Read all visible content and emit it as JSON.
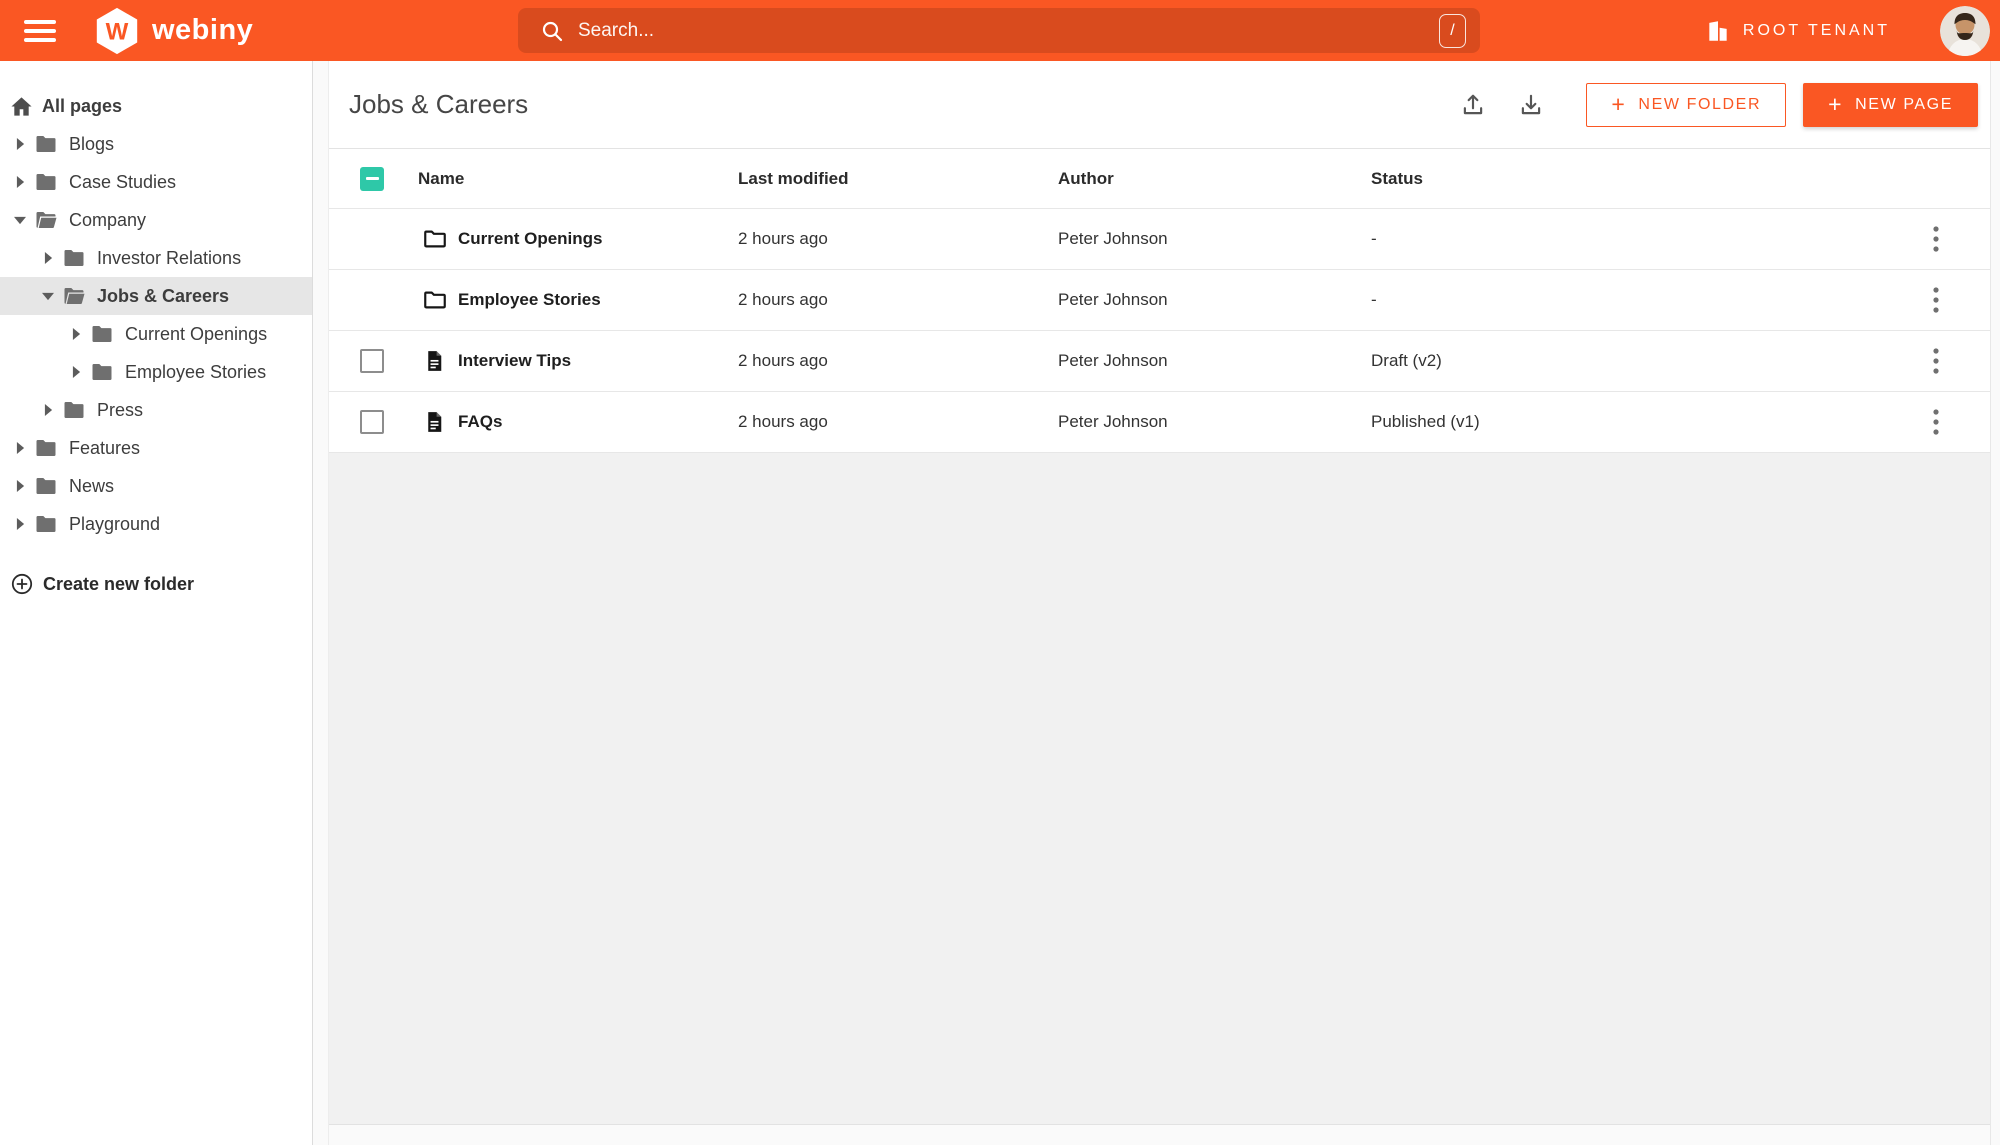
{
  "topbar": {
    "brand": "webiny",
    "search": {
      "placeholder": "Search...",
      "shortcut_key": "/"
    },
    "tenant_label": "ROOT TENANT"
  },
  "sidebar": {
    "items": [
      {
        "label": "All pages",
        "type": "home",
        "level": 0,
        "selected": false
      },
      {
        "label": "Blogs",
        "type": "folder",
        "level": 0,
        "expanded": false,
        "selected": false
      },
      {
        "label": "Case Studies",
        "type": "folder",
        "level": 0,
        "expanded": false,
        "selected": false
      },
      {
        "label": "Company",
        "type": "folder",
        "level": 0,
        "expanded": true,
        "selected": false
      },
      {
        "label": "Investor Relations",
        "type": "folder",
        "level": 1,
        "expanded": false,
        "selected": false
      },
      {
        "label": "Jobs & Careers",
        "type": "folder",
        "level": 1,
        "expanded": true,
        "selected": true
      },
      {
        "label": "Current Openings",
        "type": "folder",
        "level": 2,
        "expanded": false,
        "selected": false
      },
      {
        "label": "Employee Stories",
        "type": "folder",
        "level": 2,
        "expanded": false,
        "selected": false
      },
      {
        "label": "Press",
        "type": "folder",
        "level": 1,
        "expanded": false,
        "selected": false
      },
      {
        "label": "Features",
        "type": "folder",
        "level": 0,
        "expanded": false,
        "selected": false
      },
      {
        "label": "News",
        "type": "folder",
        "level": 0,
        "expanded": false,
        "selected": false
      },
      {
        "label": "Playground",
        "type": "folder",
        "level": 0,
        "expanded": false,
        "selected": false
      }
    ],
    "create_folder_label": "Create new folder"
  },
  "main": {
    "title": "Jobs & Careers",
    "toolbar": {
      "new_folder_label": "NEW FOLDER",
      "new_page_label": "NEW PAGE",
      "plus": "+"
    },
    "table": {
      "select_all_state": "indeterminate",
      "columns": {
        "name": "Name",
        "modified": "Last modified",
        "author": "Author",
        "status": "Status"
      },
      "rows": [
        {
          "name": "Current Openings",
          "type": "folder",
          "modified": "2 hours ago",
          "author": "Peter Johnson",
          "status": "-"
        },
        {
          "name": "Employee Stories",
          "type": "folder",
          "modified": "2 hours ago",
          "author": "Peter Johnson",
          "status": "-"
        },
        {
          "name": "Interview Tips",
          "type": "page",
          "modified": "2 hours ago",
          "author": "Peter Johnson",
          "status": "Draft (v2)"
        },
        {
          "name": "FAQs",
          "type": "page",
          "modified": "2 hours ago",
          "author": "Peter Johnson",
          "status": "Published (v1)"
        }
      ]
    }
  },
  "colors": {
    "accent_orange": "#fa5723",
    "checkbox_teal": "#2ec8a8",
    "empty_bg": "#f1f1f1"
  },
  "icons": {
    "hamburger": "menu-3-bars",
    "logo": "hexagon-w",
    "search": "magnifier",
    "tenant": "building",
    "home": "house",
    "folder_closed": "filled-folder",
    "folder_open": "open-folder",
    "chevron_right": "triangle-right",
    "chevron_down": "triangle-down",
    "create_folder": "circle-plus",
    "export": "upload-tray",
    "import": "download-tray",
    "row_folder": "outline-folder",
    "row_page": "document",
    "row_menu": "kebab-3-dots"
  }
}
